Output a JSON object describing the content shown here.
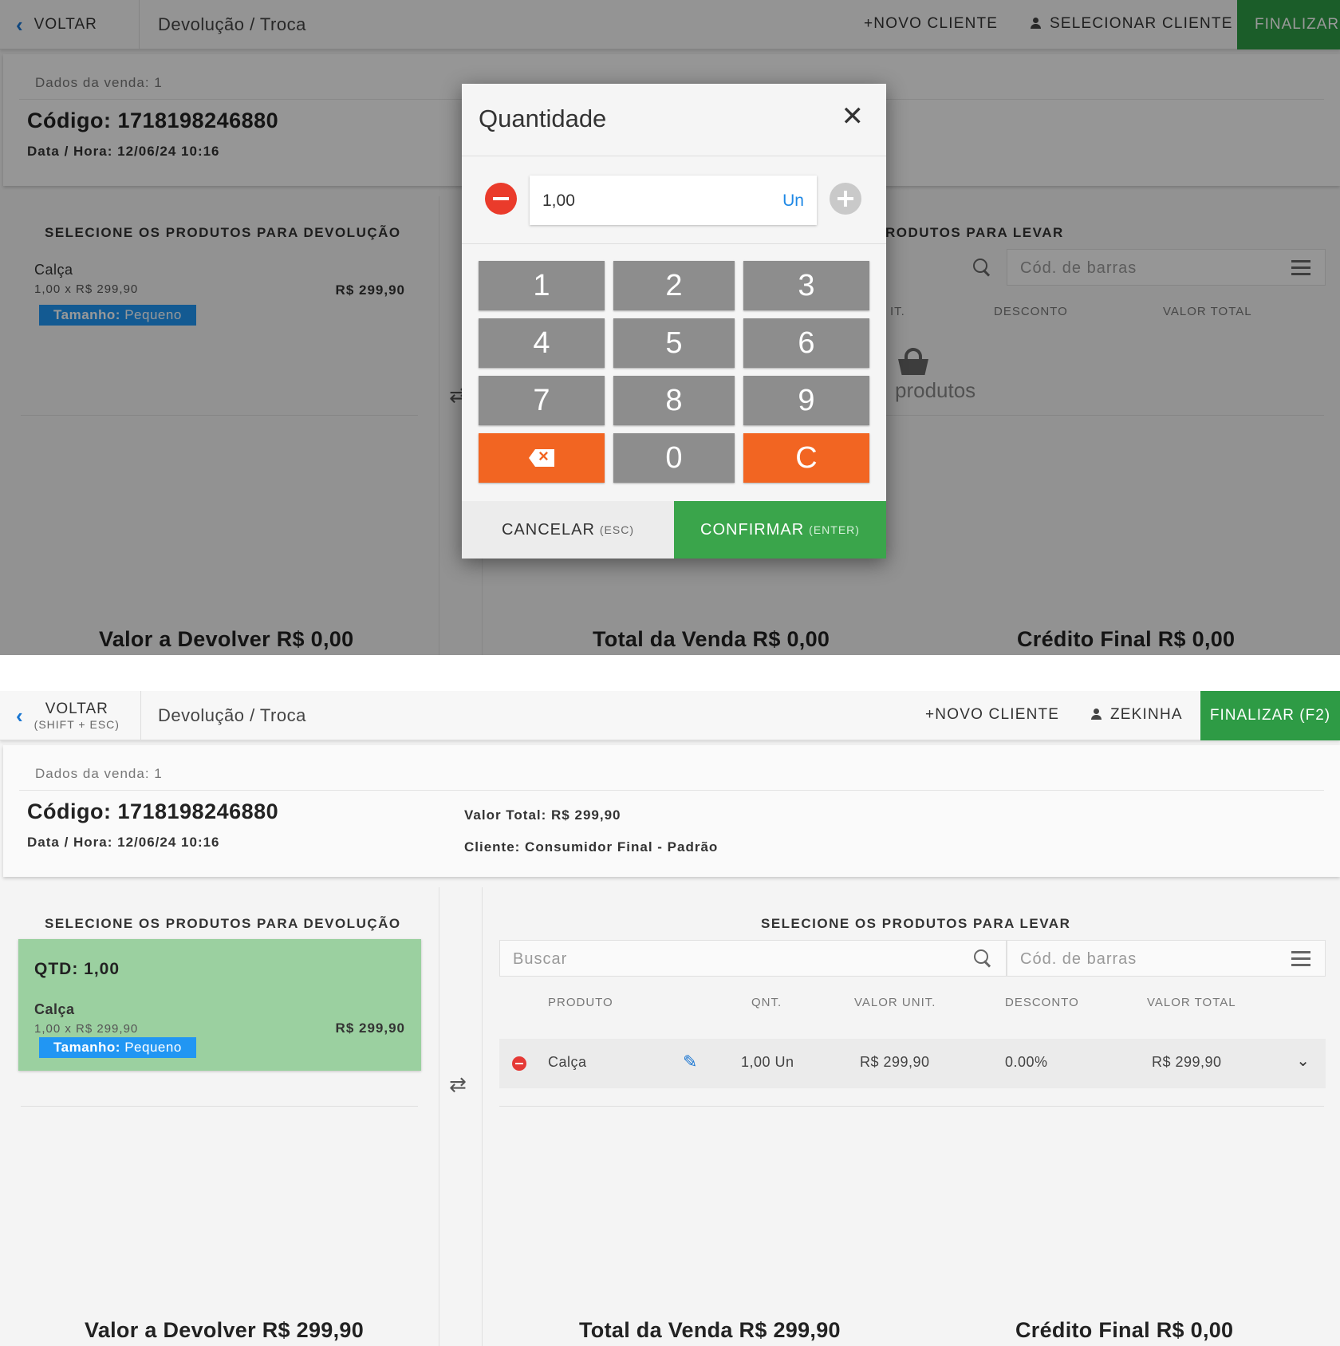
{
  "screen1": {
    "header": {
      "back_label": "VOLTAR",
      "title": "Devolução / Troca",
      "new_client": "+NOVO CLIENTE",
      "select_client": "SELECIONAR CLIENTE",
      "finalize": "FINALIZAR"
    },
    "info": {
      "sale_data": "Dados da venda: 1",
      "code": "Código: 1718198246880",
      "datetime": "Data / Hora: 12/06/24 10:16"
    },
    "left": {
      "title": "SELECIONE OS PRODUTOS PARA DEVOLUÇÃO",
      "product": {
        "name": "Calça",
        "detail": "1,00 x R$ 299,90",
        "price": "R$ 299,90",
        "tag_key": "Tamanho:",
        "tag_value": "Pequeno"
      }
    },
    "right": {
      "title_partial": "RODUTOS PARA LEVAR",
      "barcode_placeholder": "Cód. de barras",
      "col_partial": "IT.",
      "col_discount": "DESCONTO",
      "col_total": "VALOR TOTAL",
      "empty_partial": "produtos"
    },
    "totals": {
      "refund": "Valor a Devolver R$ 0,00",
      "sale": "Total da Venda R$ 0,00",
      "credit": "Crédito Final R$ 0,00"
    },
    "dialog": {
      "title": "Quantidade",
      "value": "1,00",
      "unit": "Un",
      "keys": [
        "1",
        "2",
        "3",
        "4",
        "5",
        "6",
        "7",
        "8",
        "9",
        "0",
        "C"
      ],
      "cancel": "CANCELAR",
      "cancel_hint": "(ESC)",
      "confirm": "CONFIRMAR",
      "confirm_hint": "(ENTER)"
    }
  },
  "screen2": {
    "header": {
      "back_label": "VOLTAR",
      "back_hint": "(SHIFT + ESC)",
      "title": "Devolução / Troca",
      "new_client": "+NOVO CLIENTE",
      "client_name": "ZEKINHA",
      "finalize": "FINALIZAR (F2)"
    },
    "info": {
      "sale_data": "Dados da venda: 1",
      "code": "Código: 1718198246880",
      "datetime": "Data / Hora: 12/06/24 10:16",
      "total_value": "Valor Total: R$ 299,90",
      "client": "Cliente: Consumidor Final - Padrão"
    },
    "left": {
      "title": "SELECIONE OS PRODUTOS PARA DEVOLUÇÃO",
      "product": {
        "qty": "QTD: 1,00",
        "name": "Calça",
        "detail": "1,00 x R$ 299,90",
        "price": "R$ 299,90",
        "tag_key": "Tamanho:",
        "tag_value": "Pequeno"
      }
    },
    "right": {
      "title": "SELECIONE OS PRODUTOS PARA LEVAR",
      "search_placeholder": "Buscar",
      "barcode_placeholder": "Cód. de barras",
      "columns": [
        "PRODUTO",
        "QNT.",
        "VALOR UNIT.",
        "DESCONTO",
        "VALOR TOTAL"
      ],
      "row": {
        "product": "Calça",
        "qty": "1,00 Un",
        "unit": "R$ 299,90",
        "discount": "0.00%",
        "total": "R$ 299,90"
      }
    },
    "totals": {
      "refund": "Valor a Devolver R$ 299,90",
      "sale": "Total da Venda R$ 299,90",
      "credit": "Crédito Final R$ 0,00"
    }
  }
}
